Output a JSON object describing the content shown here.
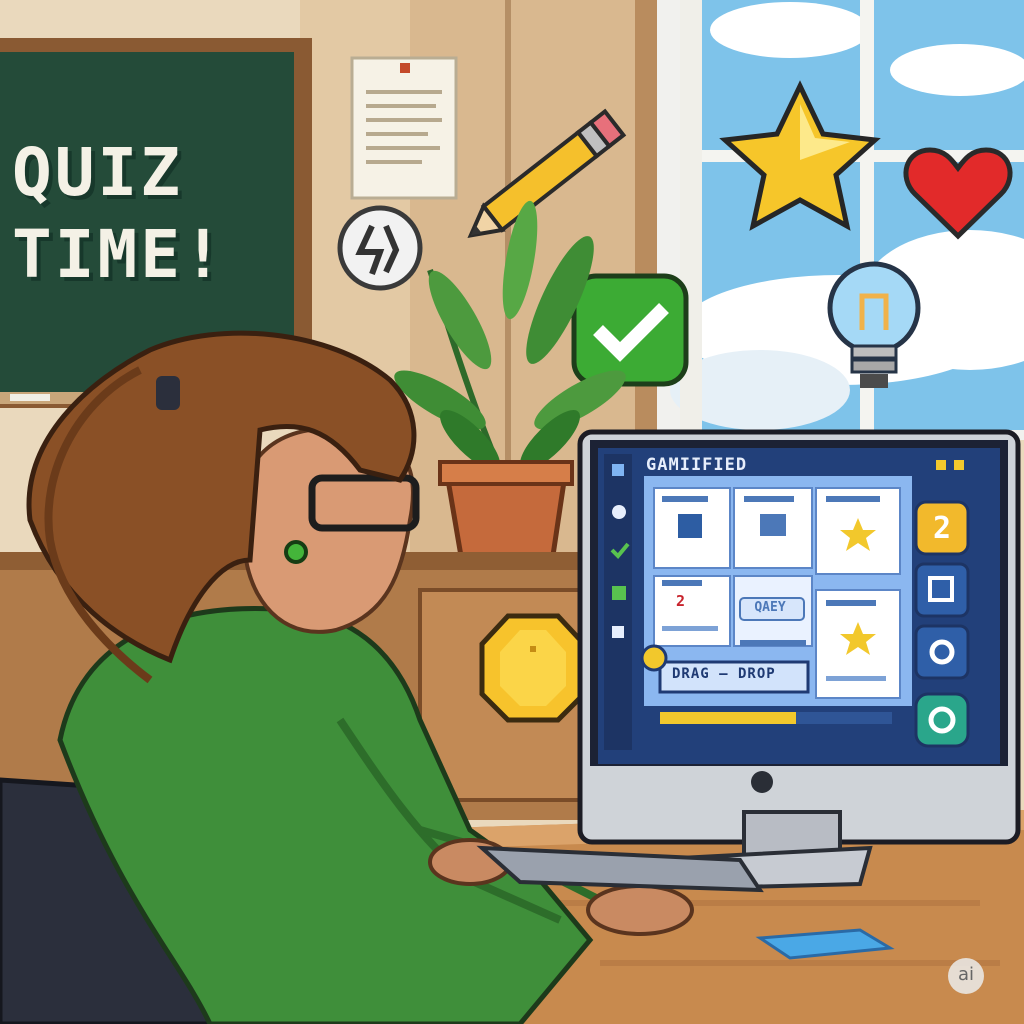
{
  "scene": {
    "chalkboard": {
      "line1": "QUIZ",
      "line2": "TIME!"
    },
    "monitor": {
      "app_title": "GAMIIFIED",
      "level_badge": "2",
      "card_number": "2",
      "query_chip": "QAEY",
      "drag_label": "DRAG – DROP"
    },
    "watermark": "ai"
  },
  "colors": {
    "chalkboard": "#244b39",
    "hoodie": "#3f8f3a",
    "screen_bg": "#22407a",
    "accent_yellow": "#f2c82c",
    "check_green": "#3cab34"
  },
  "icons": [
    "note-icon",
    "pencil-icon",
    "star-icon",
    "heart-icon",
    "timer-icon",
    "check-icon",
    "lightbulb-icon",
    "coin-icon"
  ]
}
